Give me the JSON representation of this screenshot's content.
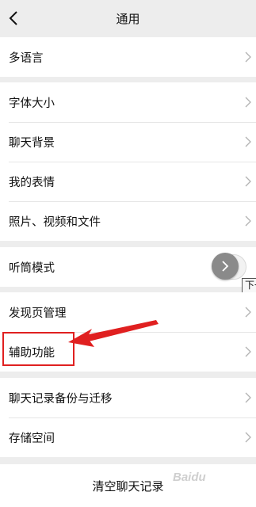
{
  "header": {
    "title": "通用",
    "back_icon": "chevron-left-icon"
  },
  "groups": [
    {
      "items": [
        {
          "label": "多语言"
        }
      ]
    },
    {
      "items": [
        {
          "label": "字体大小"
        },
        {
          "label": "聊天背景"
        },
        {
          "label": "我的表情"
        },
        {
          "label": "照片、视频和文件"
        }
      ]
    },
    {
      "items": [
        {
          "label": "听筒模式"
        }
      ]
    },
    {
      "items": [
        {
          "label": "发现页管理"
        },
        {
          "label": "辅助功能"
        }
      ]
    },
    {
      "items": [
        {
          "label": "聊天记录备份与迁移"
        },
        {
          "label": "存储空间"
        }
      ]
    }
  ],
  "toggle": {
    "state": "off"
  },
  "tooltip": {
    "text": "下一步"
  },
  "clear_button": {
    "label": "清空聊天记录"
  },
  "watermark": {
    "text": "Baidu"
  },
  "annotation": {
    "color": "#e02020"
  }
}
